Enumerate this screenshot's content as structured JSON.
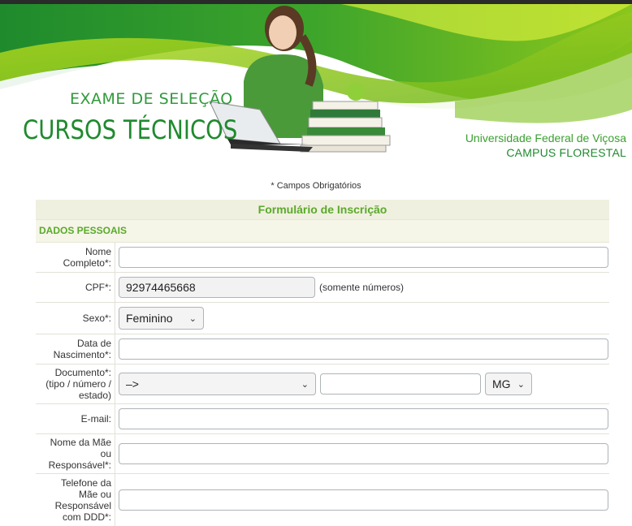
{
  "banner": {
    "exame_label": "EXAME DE SELEÇÃO",
    "cursos_label": "CURSOS TÉCNICOS",
    "university": "Universidade Federal de Viçosa",
    "campus": "CAMPUS FLORESTAL"
  },
  "required_note": "* Campos Obrigatórios",
  "form": {
    "title": "Formulário de Inscrição",
    "section": "DADOS PESSOAIS",
    "fields": {
      "nome": {
        "label_line1": "Nome",
        "label_line2": "Completo*:",
        "value": ""
      },
      "cpf": {
        "label": "CPF*:",
        "value": "92974465668",
        "hint": "(somente números)"
      },
      "sexo": {
        "label": "Sexo*:",
        "selected": "Feminino"
      },
      "nascimento": {
        "label_line1": "Data de",
        "label_line2": "Nascimento*:",
        "value": ""
      },
      "documento": {
        "label_line1": "Documento*:",
        "label_line2": "(tipo / número /",
        "label_line3": "estado)",
        "tipo_selected": "–>",
        "numero": "",
        "estado_selected": "MG"
      },
      "email": {
        "label": "E-mail:",
        "value": ""
      },
      "mae": {
        "label_line1": "Nome da Mãe",
        "label_line2": "ou",
        "label_line3": "Responsável*:",
        "value": ""
      },
      "telefone": {
        "label_line1": "Telefone da",
        "label_line2": "Mãe ou",
        "label_line3": "Responsável",
        "label_line4": "com DDD*:",
        "value": ""
      }
    }
  },
  "colors": {
    "accent_green": "#5aaa2a",
    "banner_green": "#1f8a2e",
    "light_green": "#9ed21a"
  }
}
